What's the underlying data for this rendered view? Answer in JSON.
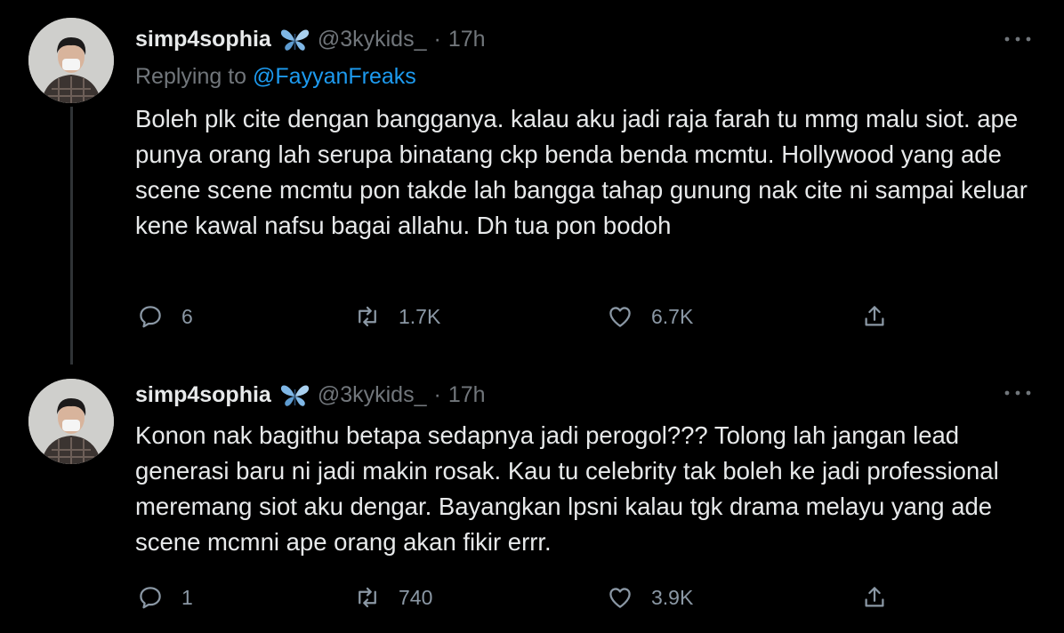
{
  "tweets": [
    {
      "author": {
        "display_name": "simp4sophia",
        "handle": "@3kykids_",
        "badge_icon": "butterfly-icon"
      },
      "separator": "·",
      "timestamp": "17h",
      "replying_prefix": "Replying to",
      "replying_to": "@FayyanFreaks",
      "text": "Boleh plk cite dengan bangganya. kalau aku jadi raja farah tu mmg malu siot. ape punya orang lah serupa binatang ckp benda benda mcmtu. Hollywood yang ade scene scene mcmtu pon takde lah bangga tahap gunung nak cite ni sampai keluar kene kawal nafsu bagai allahu. Dh tua pon bodoh",
      "stats": {
        "replies": "6",
        "retweets": "1.7K",
        "likes": "6.7K"
      }
    },
    {
      "author": {
        "display_name": "simp4sophia",
        "handle": "@3kykids_",
        "badge_icon": "butterfly-icon"
      },
      "separator": "·",
      "timestamp": "17h",
      "text": "Konon nak bagithu betapa sedapnya jadi perogol??? Tolong lah jangan lead generasi baru ni jadi makin rosak. Kau tu celebrity tak boleh ke jadi professional meremang siot aku dengar. Bayangkan lpsni kalau tgk drama melayu yang ade scene mcmni ape orang akan fikir errr.",
      "stats": {
        "replies": "1",
        "retweets": "740",
        "likes": "3.9K"
      }
    }
  ],
  "colors": {
    "background": "#000000",
    "primary_text": "#e7e9ea",
    "secondary_text": "#71767b",
    "link": "#1d9bf0",
    "action_icon": "#8b98a5",
    "thread_line": "#2f3336"
  },
  "icons": {
    "reply": "reply-bubble-icon",
    "retweet": "retweet-arrows-icon",
    "like": "heart-icon",
    "share": "share-upload-icon",
    "more": "more-dots-icon"
  }
}
